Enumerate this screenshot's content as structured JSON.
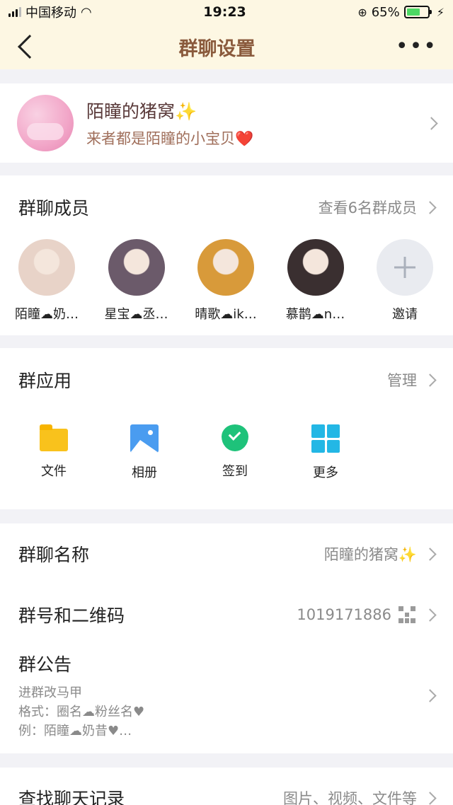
{
  "status_bar": {
    "carrier": "中国移动",
    "time": "19:23",
    "battery_percent": "65%",
    "battery_level": 0.65
  },
  "nav": {
    "title": "群聊设置",
    "back_icon": "chevron-left-icon",
    "more_icon": "ellipsis-icon"
  },
  "group": {
    "name": "陌瞳的猪窝✨",
    "description": "来者都是陌瞳的小宝贝❤️"
  },
  "members": {
    "label": "群聊成员",
    "view_all": "查看6名群成员",
    "list": [
      {
        "name": "陌瞳☁奶…",
        "color": "#e8d3c8"
      },
      {
        "name": "星宝☁丞…",
        "color": "#6b5a6a"
      },
      {
        "name": "晴歌☁ik…",
        "color": "#d89a3a"
      },
      {
        "name": "慕鹊☁n…",
        "color": "#3a2f30"
      }
    ],
    "invite_label": "邀请"
  },
  "apps": {
    "label": "群应用",
    "manage": "管理",
    "items": [
      {
        "label": "文件",
        "icon": "folder-icon"
      },
      {
        "label": "相册",
        "icon": "photo-icon"
      },
      {
        "label": "签到",
        "icon": "check-in-icon"
      },
      {
        "label": "更多",
        "icon": "grid-more-icon"
      }
    ]
  },
  "settings": {
    "name_label": "群聊名称",
    "name_value": "陌瞳的猪窝✨",
    "number_label": "群号和二维码",
    "number_value": "1019171886",
    "notice_label": "群公告",
    "notice_lines": [
      "进群改马甲",
      "格式：圈名☁粉丝名♥",
      "例：陌瞳☁奶昔♥…"
    ]
  },
  "search": {
    "label": "查找聊天记录",
    "hint": "图片、视频、文件等"
  }
}
